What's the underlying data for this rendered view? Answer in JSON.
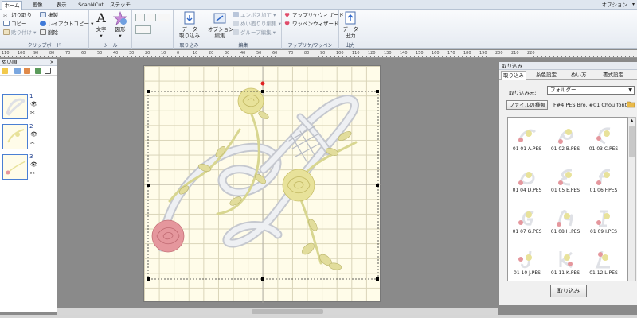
{
  "tabs": [
    "ホーム",
    "画像",
    "表示",
    "ScanNCut",
    "ステッチ"
  ],
  "options_label": "オプション",
  "ribbon": {
    "clipboard": {
      "cut": "切り取り",
      "copy": "コピー",
      "paste": "貼り付け",
      "duplicate": "複製",
      "layout_copy": "レイアウトコピー",
      "delete": "削除",
      "label": "クリップボード"
    },
    "tools": {
      "text": "文字",
      "shape": "図形",
      "label": "ツール"
    },
    "import": {
      "data_import": "データ\n取り込み",
      "label": "取り込み"
    },
    "edit": {
      "option_edit": "オプション\n編集",
      "emboss": "エンボス加工",
      "fill_edit": "ぬい面りり編集",
      "group_edit": "グループ編集",
      "label": "編集"
    },
    "apps": {
      "applique_wizard": "アップリケウィザード",
      "patch_wizard": "ワッペンウィザード",
      "label": "アップリケ/ワッペン"
    },
    "output": {
      "data_output": "データ\n出力",
      "label": "出力"
    }
  },
  "ruler_labels": [
    "110",
    "100",
    "90",
    "80",
    "70",
    "60",
    "50",
    "40",
    "30",
    "20",
    "10",
    "0",
    "10",
    "20",
    "30",
    "40",
    "50",
    "60",
    "70",
    "80",
    "90",
    "100",
    "110",
    "120",
    "130",
    "140",
    "150",
    "160",
    "170",
    "180",
    "190",
    "200",
    "210",
    "220"
  ],
  "left_panel": {
    "title": "ぬい順",
    "close": "×",
    "items": [
      {
        "num": "1"
      },
      {
        "num": "2"
      },
      {
        "num": "3"
      }
    ]
  },
  "right_panel": {
    "title": "取り込み",
    "tabs": [
      "取り込み",
      "糸色設定",
      "ぬい方...",
      "書式設定"
    ],
    "from_label": "取り込み元:",
    "from_value": "フォルダー",
    "filetype_button": "ファイルの種類",
    "filetype_value": "F#4 PES   Bro..#01 Chou font",
    "files": [
      "01 01 A.PES",
      "01 02 B.PES",
      "01 03 C.PES",
      "01 04 D.PES",
      "01 05 E.PES",
      "01 06 F.PES",
      "01 07 G.PES",
      "01 08 H.PES",
      "01 09 I.PES",
      "01 10 J.PES",
      "01 11 K.PES",
      "01 12 L.PES"
    ],
    "import_button": "取り込み"
  },
  "colors": {
    "canvas_bg": "#fffce9",
    "rose_yellow": "#e8e29a",
    "rose_pink": "#e5979d",
    "leaf_green": "#d8d690",
    "silver": "#dfe1e6"
  }
}
